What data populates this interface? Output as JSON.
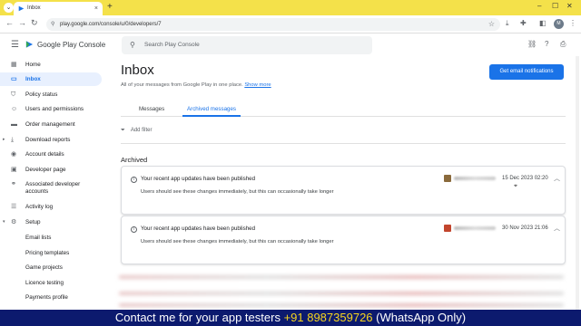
{
  "browser": {
    "tab_title": "Inbox",
    "tab_close": "×",
    "new_tab": "+",
    "url": "play.google.com/console/u/0/developers/7",
    "profile_initial": "M",
    "window_controls": [
      "‒",
      "☐",
      "✕"
    ]
  },
  "app": {
    "name": "Google Play Console",
    "search_placeholder": "Search Play Console"
  },
  "sidebar": {
    "items": [
      {
        "label": "Home",
        "icon": "home-icon",
        "glyph": "▦"
      },
      {
        "label": "Inbox",
        "icon": "inbox-icon",
        "glyph": "▭",
        "active": true
      },
      {
        "label": "Policy status",
        "icon": "shield-icon",
        "glyph": "⛉"
      },
      {
        "label": "Users and permissions",
        "icon": "users-icon",
        "glyph": "☺"
      },
      {
        "label": "Order management",
        "icon": "card-icon",
        "glyph": "▬"
      },
      {
        "label": "Download reports",
        "icon": "download-icon",
        "glyph": "⤓",
        "caret": "▸"
      },
      {
        "label": "Account details",
        "icon": "account-icon",
        "glyph": "◉"
      },
      {
        "label": "Developer page",
        "icon": "page-icon",
        "glyph": "▣"
      },
      {
        "label": "Associated developer accounts",
        "icon": "link-accounts-icon",
        "glyph": "⚭",
        "two_line": true
      },
      {
        "label": "Activity log",
        "icon": "activity-icon",
        "glyph": "☰"
      },
      {
        "label": "Setup",
        "icon": "gear-icon",
        "glyph": "⚙",
        "caret": "▾"
      },
      {
        "label": "Email lists",
        "icon": "",
        "glyph": ""
      },
      {
        "label": "Pricing templates",
        "icon": "",
        "glyph": ""
      },
      {
        "label": "Game projects",
        "icon": "",
        "glyph": ""
      },
      {
        "label": "Licence testing",
        "icon": "",
        "glyph": ""
      },
      {
        "label": "Payments profile",
        "icon": "",
        "glyph": ""
      }
    ]
  },
  "main": {
    "title": "Inbox",
    "subtitle": "All of your messages from Google Play in one place.",
    "show_more": "Show more",
    "primary_button": "Get email notifications",
    "tabs": [
      {
        "label": "Messages",
        "active": false
      },
      {
        "label": "Archived messages",
        "active": true
      }
    ],
    "filter_label": "Add filter",
    "section_heading": "Archived",
    "messages": [
      {
        "title": "Your recent app updates have been published",
        "body": "Users should see these changes immediately, but this can occasionally take longer",
        "date": "15 Dec 2023 02:20",
        "app_color": "#8a6a3c"
      },
      {
        "title": "Your recent app updates have been published",
        "body": "Users should see these changes immediately, but this can occasionally take longer",
        "date": "30 Nov 2023 21:06",
        "app_color": "#c2452d"
      }
    ]
  },
  "banner": {
    "prefix": "Contact me for your app testers ",
    "phone": "+91 8987359726",
    "suffix": " (WhatsApp Only)"
  },
  "colors": {
    "accent": "#1a73e8",
    "tab_strip": "#f4e14a",
    "banner_bg": "#0c1a6e",
    "banner_highlight": "#f7d51e"
  }
}
